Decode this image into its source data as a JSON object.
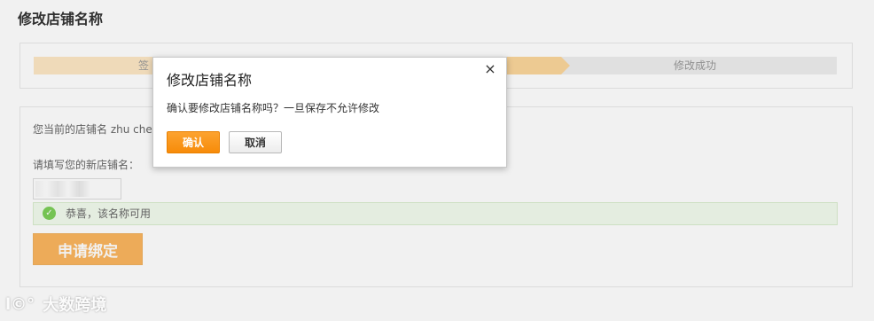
{
  "page": {
    "title": "修改店铺名称"
  },
  "steps": {
    "first_label": "签",
    "last_label": "修改成功"
  },
  "form": {
    "current_name_text": "您当前的店铺名 zhu cher",
    "new_name_label": "请填写您的新店铺名：",
    "new_name_value": "",
    "success_icon": "check-circle-icon",
    "success_text": "恭喜，该名称可用",
    "bind_button_label": "申请绑定"
  },
  "dialog": {
    "title": "修改店铺名称",
    "close_label": "×",
    "message": "确认要修改店铺名称吗？一旦保存不允许修改",
    "confirm_label": "确认",
    "cancel_label": "取消"
  },
  "watermark": {
    "logo": "l©°",
    "text": "大数跨境"
  },
  "colors": {
    "accent_orange": "#f78b09",
    "success_green": "#7ccf58",
    "step_done": "#fde7c4"
  }
}
